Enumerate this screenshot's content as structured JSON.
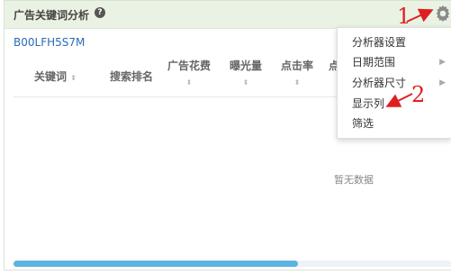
{
  "panel": {
    "title": "广告关键词分析",
    "help_symbol": "?",
    "asin": "B00LFH5S7M"
  },
  "table": {
    "columns": [
      {
        "label": "关键词",
        "sortable": true
      },
      {
        "label": "搜索排名",
        "sortable": false
      },
      {
        "label": "广告花费",
        "sortable": true
      },
      {
        "label": "曝光量",
        "sortable": true
      },
      {
        "label": "点击率",
        "sortable": true
      },
      {
        "label": "点",
        "sortable": false
      }
    ],
    "sort_symbol": "⬍",
    "empty_text": "暂无数据"
  },
  "menu": {
    "items": [
      {
        "label": "分析器设置",
        "has_submenu": false
      },
      {
        "label": "日期范围",
        "has_submenu": true
      },
      {
        "label": "分析器尺寸",
        "has_submenu": true
      },
      {
        "label": "显示列",
        "has_submenu": false
      },
      {
        "label": "筛选",
        "has_submenu": false
      }
    ],
    "submenu_symbol": "▶"
  },
  "annotations": {
    "number_1": "1",
    "number_2": "2",
    "color": "#e02020"
  },
  "colors": {
    "header_bg": "#eaf3e3",
    "link": "#2a6bb5",
    "scrollbar": "#5cb4e0"
  }
}
